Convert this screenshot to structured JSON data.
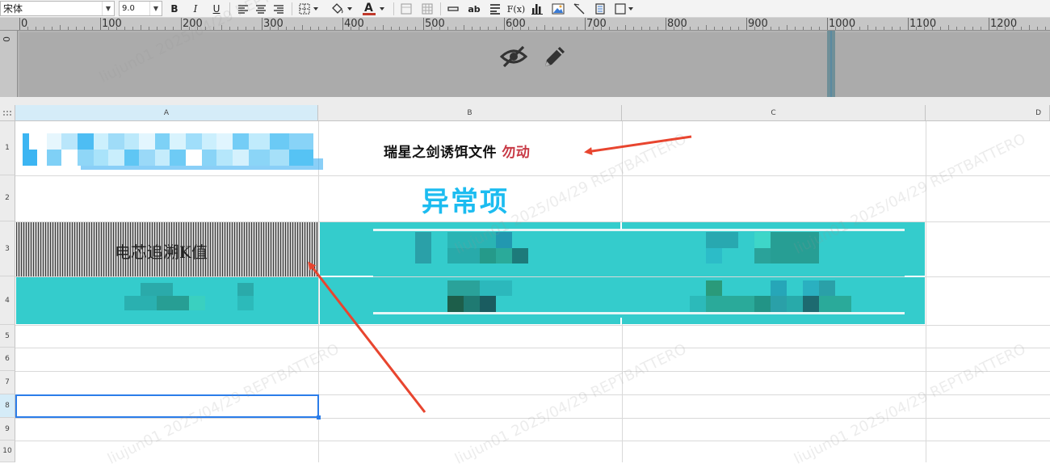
{
  "toolbar": {
    "font_name": "宋体",
    "font_size": "9.0",
    "bold_label": "B",
    "italic_label": "I",
    "underline_label": "U",
    "abc_label": "ab",
    "formula_label": "F(x)",
    "icons": [
      "bold-icon",
      "italic-icon",
      "underline-icon",
      "align-left-icon",
      "align-center-icon",
      "align-right-icon",
      "border-icon",
      "fill-color-icon",
      "font-color-icon",
      "merge-icon",
      "grid-icon",
      "insert-row-icon",
      "text-icon",
      "wrap-icon",
      "formula-icon",
      "chart-icon",
      "image-icon",
      "slash-icon",
      "page-icon",
      "frame-icon"
    ],
    "font_color": "#c0392b"
  },
  "ruler": {
    "labels": [
      "0",
      "100",
      "200",
      "300",
      "400",
      "500",
      "600",
      "700",
      "800",
      "900",
      "1000",
      "1100",
      "1200"
    ],
    "left_label": "0"
  },
  "sheet": {
    "columns": [
      "A",
      "B",
      "C",
      "D"
    ],
    "rows": [
      "1",
      "2",
      "3",
      "4",
      "5",
      "6",
      "7",
      "8",
      "9",
      "10"
    ],
    "selected_column": "A",
    "selected_row": "8",
    "b1_text": "瑞星之剑诱饵文件",
    "b1_red_text": "勿动",
    "b2_text": "异常项",
    "a3_text": "电芯追溯K值"
  },
  "colors": {
    "accent_blue": "#1cbcf0",
    "teal": "#34cccc",
    "selection": "#2b7de9",
    "annotation_red": "#e8452f"
  },
  "watermark_text": "liujun01 2025/04/29 REPTBATTERO"
}
